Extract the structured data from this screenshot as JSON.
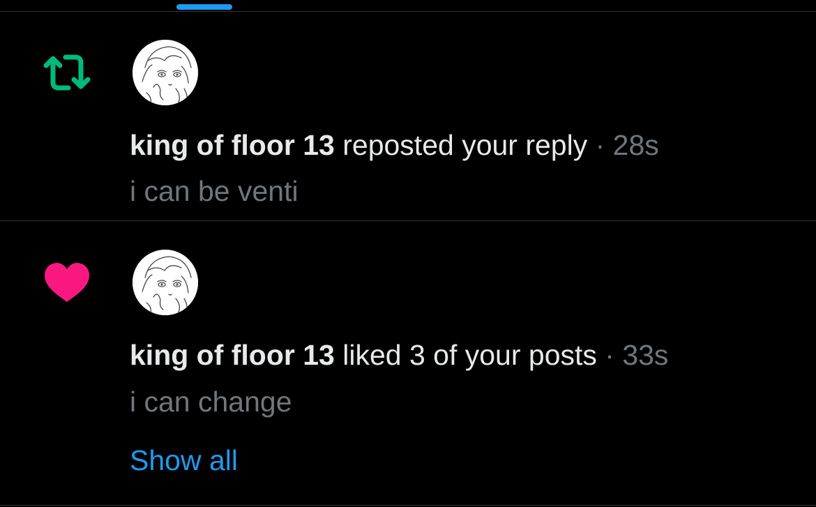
{
  "colors": {
    "background": "#000000",
    "accent": "#1d9bf0",
    "repost": "#00ba7c",
    "like": "#f91880",
    "secondary_text": "#71767b",
    "primary_text": "#e7e9ea",
    "divider": "#2f3336"
  },
  "notifications": [
    {
      "type_icon": "repost-icon",
      "actor": "king of floor 13",
      "action": " reposted your reply",
      "separator": " · ",
      "time": "28s",
      "preview": "i can be venti"
    },
    {
      "type_icon": "heart-icon",
      "actor": "king of floor 13",
      "action": " liked 3 of your posts",
      "separator": " · ",
      "time": "33s",
      "preview": "i can change",
      "show_all_label": "Show all"
    }
  ]
}
